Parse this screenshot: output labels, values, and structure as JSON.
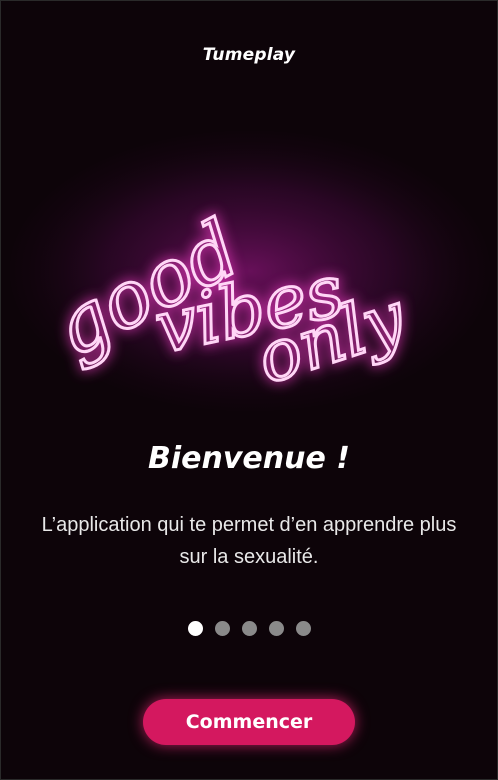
{
  "header": {
    "app_name": "Tumeplay"
  },
  "hero": {
    "neon_text_line1": "good",
    "neon_text_line2": "vibes",
    "neon_text_line3": "only",
    "neon_color": "#ff5fe0",
    "glow_color": "#b0199a"
  },
  "welcome": {
    "title": "Bienvenue !",
    "subtitle": "L’application qui te permet d’en apprendre plus sur la sexualité."
  },
  "pagination": {
    "pages": 5,
    "active_index": 0
  },
  "cta": {
    "label": "Commencer",
    "color": "#d4185f"
  }
}
